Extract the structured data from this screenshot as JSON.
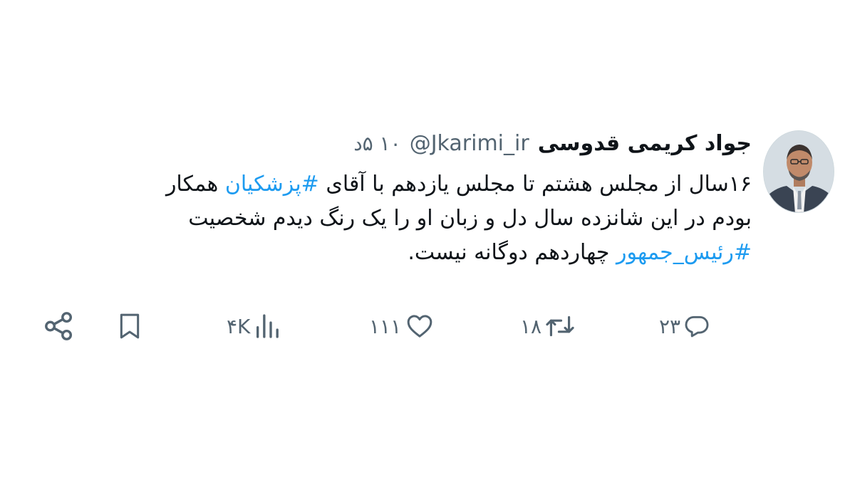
{
  "tweet": {
    "display_name": "جواد کریمی قدوسی",
    "handle": "@Jkarimi_ir",
    "time": "۱۰ ۵د",
    "lines": [
      {
        "before": "۱۶سال از مجلس هشتم تا مجلس یازدهم با آقای ",
        "hashtag": "#پزشکیان",
        "after": " همکار"
      },
      {
        "before": "بودم در این شانزده سال دل و زبان او را یک رنگ دیدم شخصیت",
        "hashtag": "",
        "after": ""
      },
      {
        "before": "",
        "hashtag": "#رئیس_جمهور",
        "after": " چهاردهم دوگانه نیست."
      }
    ]
  },
  "actions": {
    "reply_count": "۲۳",
    "retweet_count": "۱۸",
    "like_count": "۱۱۱",
    "views_count": "۴K"
  },
  "colors": {
    "hashtag": "#1d9bf0",
    "secondary_text": "#536471",
    "primary_text": "#0f1419"
  },
  "icons": [
    "reply-icon",
    "retweet-icon",
    "like-icon",
    "views-icon",
    "bookmark-icon",
    "share-icon"
  ]
}
